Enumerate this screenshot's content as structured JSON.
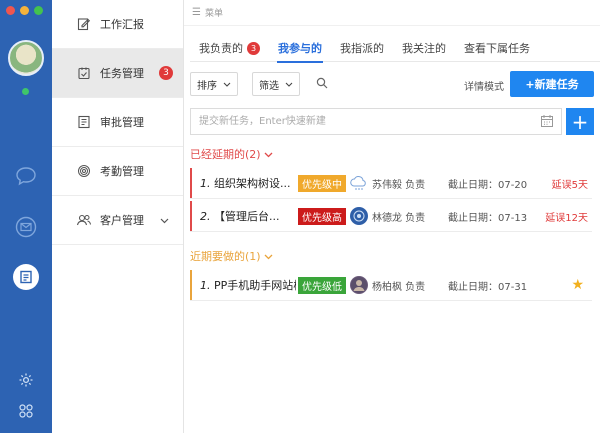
{
  "nav": {
    "items": [
      {
        "label": "工作汇报",
        "icon": "edit-icon"
      },
      {
        "label": "任务管理",
        "icon": "task-icon",
        "badge": "3"
      },
      {
        "label": "审批管理",
        "icon": "approval-icon"
      },
      {
        "label": "考勤管理",
        "icon": "fingerprint-icon"
      },
      {
        "label": "客户管理",
        "icon": "customers-icon"
      }
    ]
  },
  "menu_bar": {
    "label": "菜单"
  },
  "tabs": [
    {
      "label": "我负责的",
      "badge": "3"
    },
    {
      "label": "我参与的"
    },
    {
      "label": "我指派的"
    },
    {
      "label": "我关注的"
    },
    {
      "label": "查看下属任务"
    }
  ],
  "toolbar": {
    "sort_label": "排序",
    "filter_label": "筛选",
    "detail_mode_label": "详情模式",
    "new_task_label": "+新建任务"
  },
  "quick_add": {
    "placeholder": "提交新任务，Enter快速新建"
  },
  "groups": {
    "overdue_title": "已经延期的(2)",
    "upcoming_title": "近期要做的(1)"
  },
  "tasks": [
    {
      "num": "1.",
      "title": "组织架构树设...",
      "priority": "优先级中",
      "owner": "苏伟毅 负责",
      "deadline": "截止日期：07-20",
      "delay": "延误5天"
    },
    {
      "num": "2.",
      "title": "【管理后台...",
      "priority": "优先级高",
      "owner": "林德龙 负责",
      "deadline": "截止日期：07-13",
      "delay": "延误12天"
    },
    {
      "num": "1.",
      "title": "PP手机助手网站栏目...",
      "priority": "优先级低",
      "owner": "杨柏枫 负责",
      "deadline": "截止日期：07-31"
    }
  ],
  "colors": {
    "rail": "#2d63b3",
    "accent": "#1f86f0",
    "overdue": "#e04a4a",
    "upcoming": "#e9a43c",
    "priority_mid": "#f0a92c",
    "priority_high": "#cc1b1b",
    "priority_low": "#3aa53a"
  }
}
